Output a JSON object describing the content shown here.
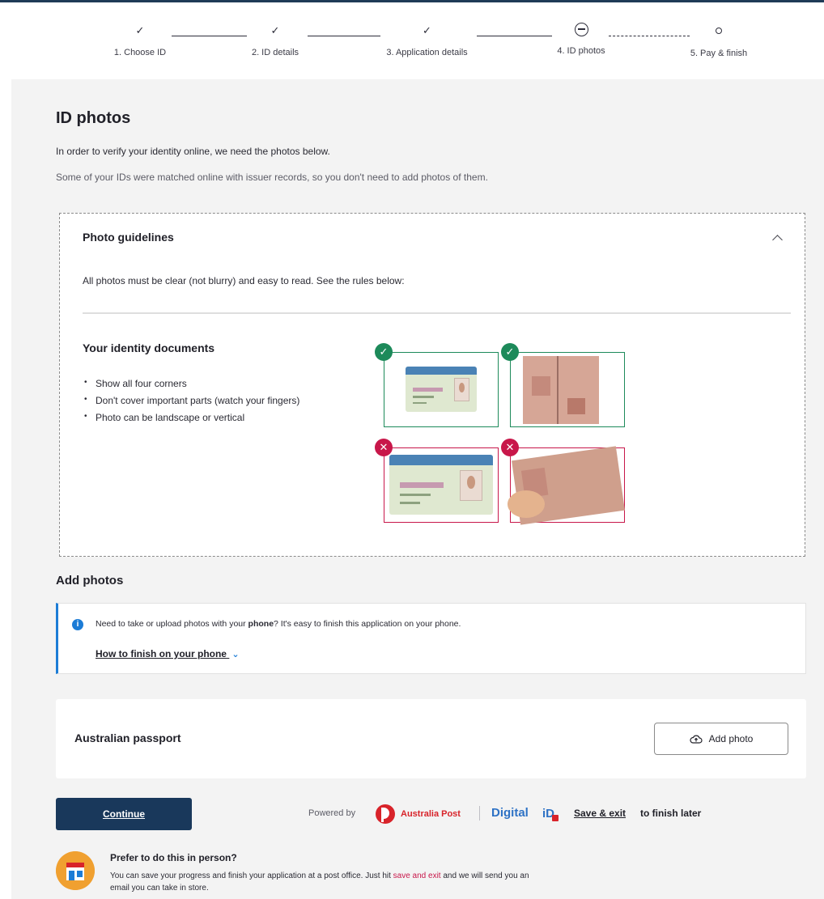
{
  "stepper": {
    "steps": [
      {
        "label": "1. Choose ID",
        "status": "complete"
      },
      {
        "label": "2. ID details",
        "status": "complete"
      },
      {
        "label": "3. Application details",
        "status": "complete"
      },
      {
        "label": "4. ID photos",
        "status": "current"
      },
      {
        "label": "5. Pay & finish",
        "status": "upcoming"
      }
    ]
  },
  "page": {
    "title": "ID photos",
    "intro": "In order to verify your identity online, we need the photos below.",
    "note": "Some of your IDs were matched online with issuer records, so you don't need to add photos of them."
  },
  "guidelines": {
    "title": "Photo guidelines",
    "description": "All photos must be clear (not blurry) and easy to read. See the rules below:",
    "section_title": "Your identity documents",
    "rules": [
      "Show all four corners",
      "Don't cover important parts (watch your fingers)",
      "Photo can be landscape or vertical"
    ]
  },
  "add_photos": {
    "title": "Add photos",
    "info_pre": "Need to take or upload photos with your ",
    "info_bold": "phone",
    "info_post": "? It's easy to finish this application on your phone.",
    "info_link": "How to finish on your phone",
    "document_label": "Australian passport",
    "add_button": "Add photo"
  },
  "footer": {
    "continue": "Continue",
    "powered_by": "Powered by",
    "brand_name": "Australia Post",
    "digital_id": "Digital iD",
    "digital_word": "Digital",
    "id_word": "iD",
    "save_exit": "Save & exit",
    "save_rest": "to finish later"
  },
  "in_person": {
    "title": "Prefer to do this in person?",
    "text_pre": "You can save your progress and finish your application at a post office. Just hit ",
    "text_link": "save and exit",
    "text_post": " and we will send you an email you can take in store."
  },
  "colors": {
    "brand_navy": "#19385b",
    "info_blue": "#1c7cd6",
    "success_green": "#1d8a5a",
    "error_red": "#c8174a",
    "auspost_red": "#d8232a"
  }
}
